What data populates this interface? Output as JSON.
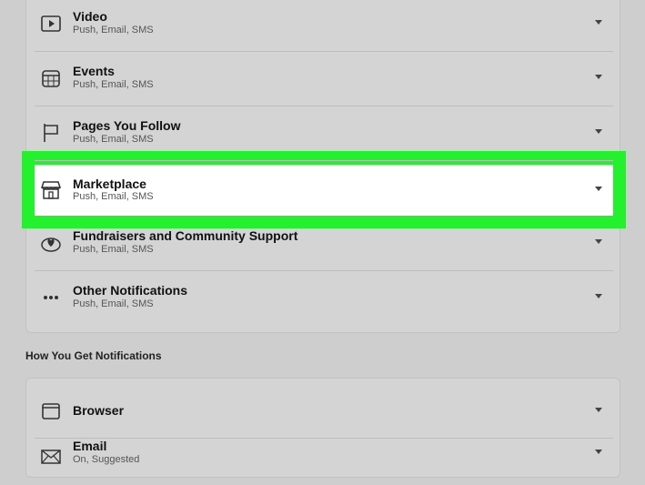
{
  "notification_types": [
    {
      "title": "Video",
      "subtitle": "Push, Email, SMS",
      "icon": "video-icon"
    },
    {
      "title": "Events",
      "subtitle": "Push, Email, SMS",
      "icon": "calendar-icon"
    },
    {
      "title": "Pages You Follow",
      "subtitle": "Push, Email, SMS",
      "icon": "flag-icon"
    },
    {
      "title": "Marketplace",
      "subtitle": "Push, Email, SMS",
      "icon": "storefront-icon",
      "highlighted": true
    },
    {
      "title": "Fundraisers and Community Support",
      "subtitle": "Push, Email, SMS",
      "icon": "fundraiser-icon"
    },
    {
      "title": "Other Notifications",
      "subtitle": "Push, Email, SMS",
      "icon": "more-icon"
    }
  ],
  "how_you_get": {
    "heading": "How You Get Notifications",
    "items": [
      {
        "title": "Browser",
        "icon": "browser-icon"
      },
      {
        "title": "Email",
        "subtitle": "On, Suggested",
        "icon": "envelope-icon"
      }
    ]
  },
  "colors": {
    "highlight": "#23f12e",
    "background": "#cecece",
    "selected_row": "#ffffff"
  }
}
